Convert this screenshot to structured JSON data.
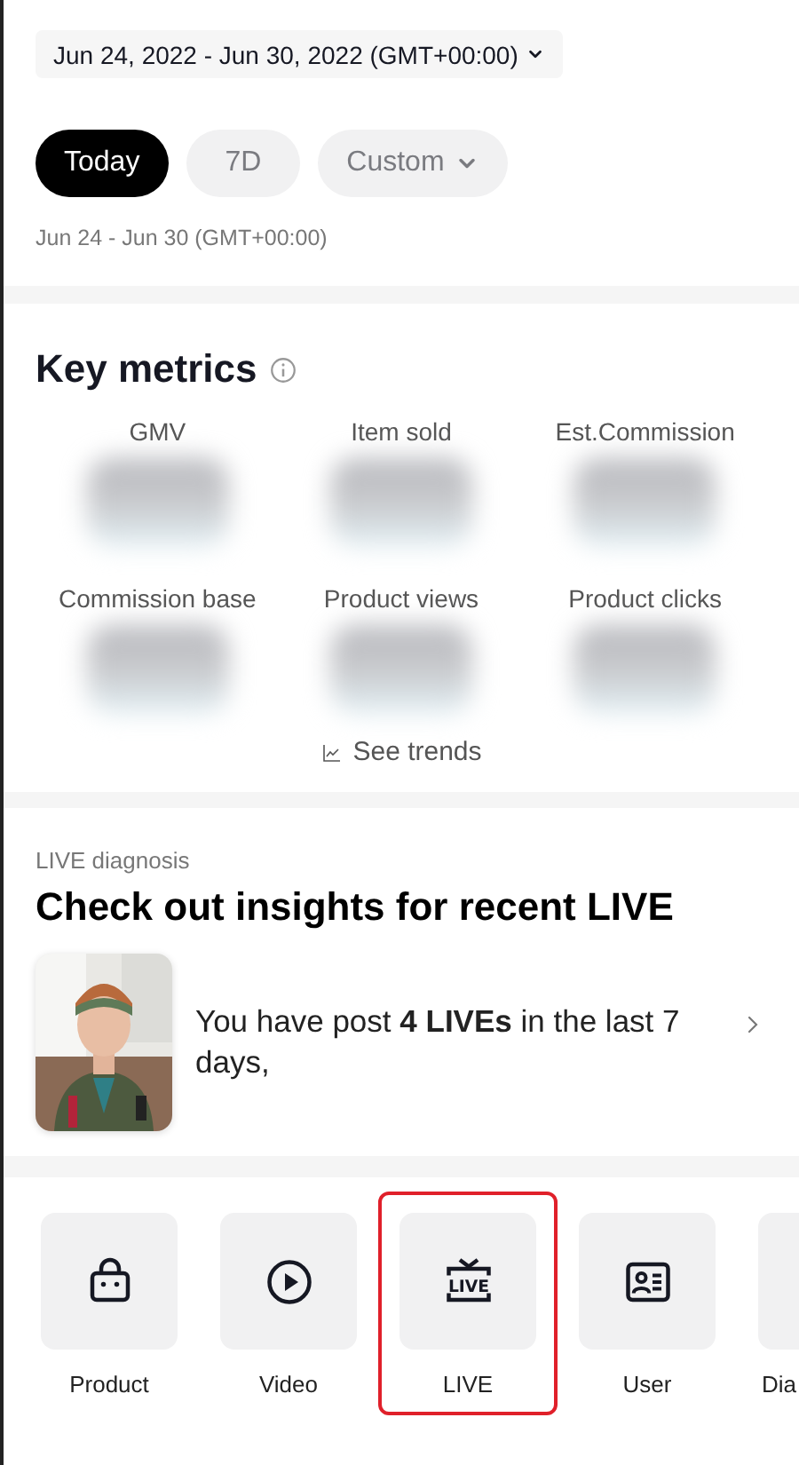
{
  "date_range": {
    "label": "Jun 24, 2022 - Jun 30, 2022 (GMT+00:00)"
  },
  "periods": [
    {
      "label": "Today",
      "selected": true,
      "kind": "plain"
    },
    {
      "label": "7D",
      "selected": false,
      "kind": "plain"
    },
    {
      "label": "Custom",
      "selected": false,
      "kind": "dropdown"
    }
  ],
  "range_note": "Jun 24 - Jun 30 (GMT+00:00)",
  "key_metrics": {
    "title": "Key metrics",
    "metrics": [
      {
        "label": "GMV"
      },
      {
        "label": "Item sold"
      },
      {
        "label": "Est.Commission"
      },
      {
        "label": "Commission base"
      },
      {
        "label": "Product views"
      },
      {
        "label": "Product clicks"
      }
    ],
    "trends_link": "See trends"
  },
  "live_diagnosis": {
    "eyebrow": "LIVE diagnosis",
    "title": "Check out insights for recent LIVE",
    "card": {
      "text": "You have post **4 LIVEs** in the last 7 days,"
    }
  },
  "shortcuts": [
    {
      "label": "Product",
      "kind": "bag",
      "highlighted": false
    },
    {
      "label": "Video",
      "kind": "play",
      "highlighted": false
    },
    {
      "label": "LIVE",
      "kind": "tv",
      "icon_text": "LIVE",
      "highlighted": true
    },
    {
      "label": "User",
      "kind": "id-card",
      "highlighted": false
    },
    {
      "label": "Dia",
      "kind": "partial",
      "highlighted": false
    }
  ]
}
